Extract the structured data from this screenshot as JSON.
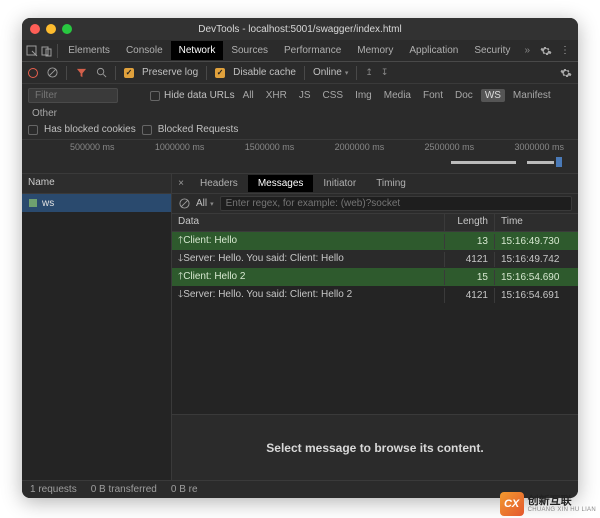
{
  "window": {
    "title": "DevTools - localhost:5001/swagger/index.html"
  },
  "tabs": [
    "Elements",
    "Console",
    "Network",
    "Sources",
    "Performance",
    "Memory",
    "Application",
    "Security"
  ],
  "activeTab": "Network",
  "toolbar": {
    "preserve_log": "Preserve log",
    "disable_cache": "Disable cache",
    "throttling": "Online"
  },
  "filterbar": {
    "placeholder": "Filter",
    "hide_data_urls": "Hide data URLs",
    "types": [
      "All",
      "XHR",
      "JS",
      "CSS",
      "Img",
      "Media",
      "Font",
      "Doc",
      "WS",
      "Manifest",
      "Other"
    ],
    "selected_type": "WS",
    "has_blocked_cookies": "Has blocked cookies",
    "blocked_requests": "Blocked Requests"
  },
  "timeline": {
    "ticks": [
      "500000 ms",
      "1000000 ms",
      "1500000 ms",
      "2000000 ms",
      "2500000 ms",
      "3000000 ms"
    ]
  },
  "requests": {
    "header": "Name",
    "rows": [
      {
        "name": "ws"
      }
    ]
  },
  "inspector": {
    "tabs": [
      "Headers",
      "Messages",
      "Initiator",
      "Timing"
    ],
    "active": "Messages",
    "filter_all": "All",
    "regex_placeholder": "Enter regex, for example: (web)?socket",
    "columns": {
      "data": "Data",
      "length": "Length",
      "time": "Time"
    },
    "messages": [
      {
        "dir": "up",
        "text": "Client: Hello",
        "length": "13",
        "time": "15:16:49.730"
      },
      {
        "dir": "down",
        "text": "Server: Hello. You said: Client: Hello",
        "length": "4121",
        "time": "15:16:49.742"
      },
      {
        "dir": "up",
        "text": "Client: Hello 2",
        "length": "15",
        "time": "15:16:54.690"
      },
      {
        "dir": "down",
        "text": "Server: Hello. You said: Client: Hello 2",
        "length": "4121",
        "time": "15:16:54.691"
      }
    ],
    "preview_empty": "Select message to browse its content."
  },
  "status": {
    "requests": "1 requests",
    "transferred": "0 B transferred",
    "resources": "0 B re"
  },
  "watermark": {
    "cn": "创新互联",
    "py": "CHUANG XIN HU LIAN"
  }
}
